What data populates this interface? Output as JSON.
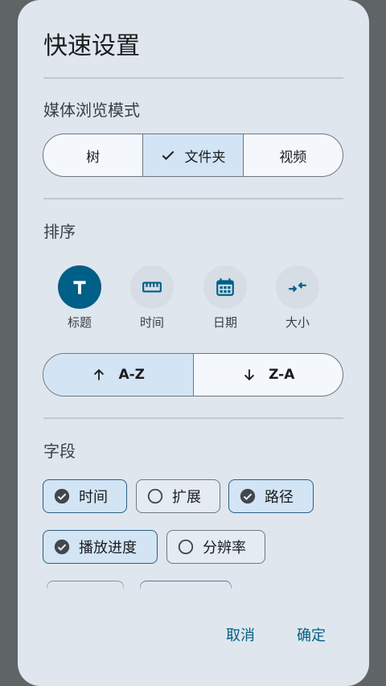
{
  "title": "快速设置",
  "browse_mode": {
    "label": "媒体浏览模式",
    "options": [
      "树",
      "文件夹",
      "视频"
    ],
    "selected": "文件夹"
  },
  "sort": {
    "label": "排序",
    "options": [
      {
        "label": "标题",
        "icon": "title-t-icon",
        "active": true
      },
      {
        "label": "时间",
        "icon": "ruler-icon",
        "active": false
      },
      {
        "label": "日期",
        "icon": "calendar-icon",
        "active": false
      },
      {
        "label": "大小",
        "icon": "compress-arrows-icon",
        "active": false
      }
    ],
    "directions": [
      "A-Z",
      "Z-A"
    ],
    "selected_direction": "A-Z"
  },
  "fields": {
    "label": "字段",
    "chips": [
      {
        "label": "时间",
        "checked": true
      },
      {
        "label": "扩展",
        "checked": false
      },
      {
        "label": "路径",
        "checked": true
      },
      {
        "label": "播放进度",
        "checked": true
      },
      {
        "label": "分辨率",
        "checked": false
      }
    ]
  },
  "actions": {
    "cancel": "取消",
    "confirm": "确定"
  },
  "colors": {
    "accent": "#005f86",
    "selected_bg": "#d3e4f5",
    "dialog_bg": "#dfe6ee"
  }
}
